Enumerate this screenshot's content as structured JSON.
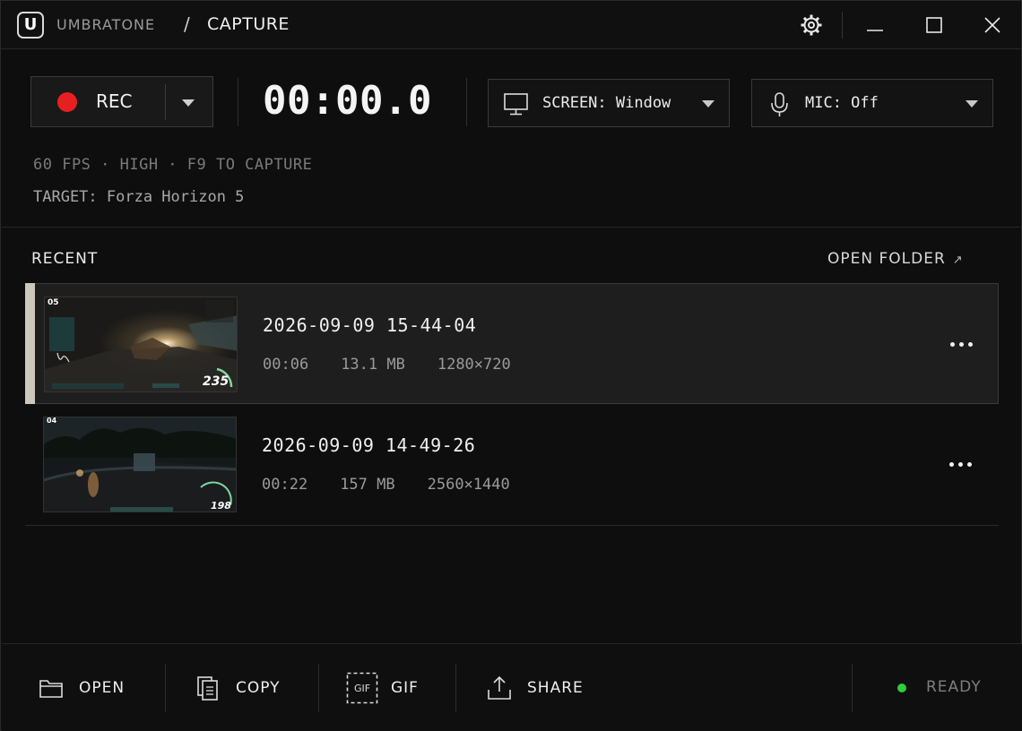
{
  "titlebar": {
    "app_name": "UMBRATONE",
    "separator": "/",
    "section": "CAPTURE",
    "logo_letter": "U"
  },
  "controls": {
    "rec_label": "REC",
    "timer": "00:00.0",
    "screen_select": "SCREEN: Window",
    "mic_select": "MIC: Off",
    "rec_color": "#e62020"
  },
  "info": {
    "settings_line": "60 FPS · HIGH · F9 TO CAPTURE",
    "target_line": "TARGET: Forza Horizon 5"
  },
  "recent": {
    "title": "RECENT",
    "open_folder": "OPEN FOLDER",
    "open_folder_arrow": "↗",
    "items": [
      {
        "name": "2026-09-09 15-44-04",
        "duration": "00:06",
        "size": "13.1 MB",
        "resolution": "1280×720",
        "hud_gear": "05",
        "hud_speed": "235",
        "selected": true
      },
      {
        "name": "2026-09-09 14-49-26",
        "duration": "00:22",
        "size": "157 MB",
        "resolution": "2560×1440",
        "hud_gear": "04",
        "hud_speed": "198",
        "selected": false
      }
    ]
  },
  "footer": {
    "open_label": "OPEN",
    "copy_label": "COPY",
    "gif_label": "GIF",
    "gif_icon_text": "GIF",
    "share_label": "SHARE",
    "status": "READY",
    "status_color": "#2ecc40"
  },
  "icons": {
    "settings": "gear-icon",
    "minimize": "minimize-icon",
    "maximize": "maximize-icon",
    "close": "close-icon",
    "screen": "monitor-icon",
    "mic": "microphone-icon",
    "open": "folder-icon",
    "copy": "copy-icon",
    "gif": "gif-icon",
    "share": "share-icon",
    "more": "more-horizontal-icon"
  }
}
